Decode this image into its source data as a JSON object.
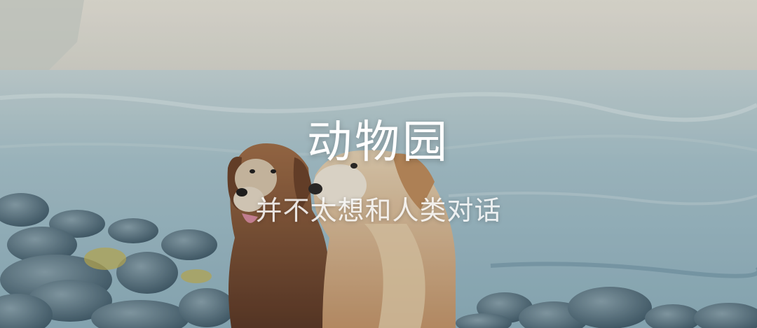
{
  "hero": {
    "title": "动物园",
    "subtitle": "并不太想和人类对话"
  },
  "colors": {
    "sky": "#e7e2d6",
    "water": "#9fbcc6",
    "rocks": "#5c7684",
    "dog_left": "#7a4a2c",
    "dog_right": "#d8b48a",
    "text": "#ffffff"
  },
  "icons": [
    "photo-background"
  ]
}
